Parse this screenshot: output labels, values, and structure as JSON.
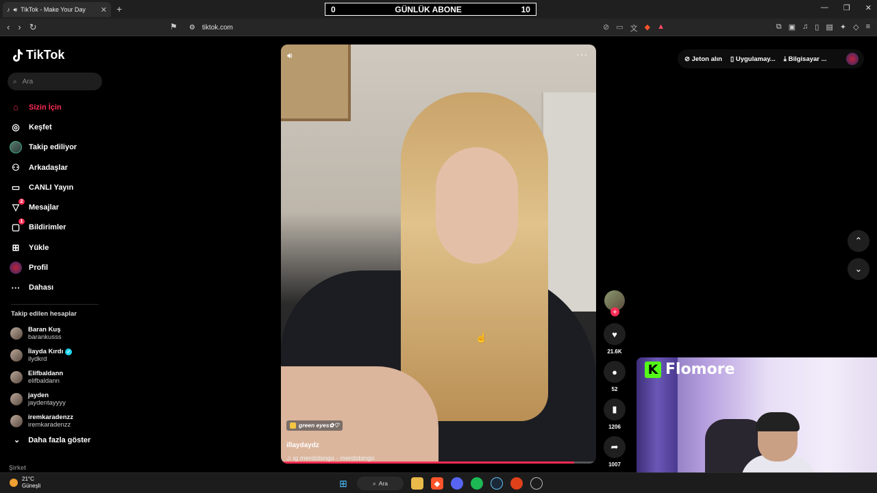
{
  "browser": {
    "tab_title": "TikTok - Make Your Day",
    "url": "tiktok.com"
  },
  "overlay": {
    "left": "0",
    "title": "GÜNLÜK ABONE",
    "right": "10"
  },
  "sidebar": {
    "logo": "TikTok",
    "search_placeholder": "Ara",
    "items": [
      {
        "label": "Sizin İçin",
        "icon": "home-icon"
      },
      {
        "label": "Keşfet",
        "icon": "compass-icon"
      },
      {
        "label": "Takip ediliyor",
        "icon": "following-avatar-icon"
      },
      {
        "label": "Arkadaşlar",
        "icon": "friends-icon"
      },
      {
        "label": "CANLI Yayın",
        "icon": "live-icon"
      },
      {
        "label": "Mesajlar",
        "icon": "messages-icon",
        "badge": "2"
      },
      {
        "label": "Bildirimler",
        "icon": "notifications-icon",
        "badge": "1"
      },
      {
        "label": "Yükle",
        "icon": "upload-icon"
      },
      {
        "label": "Profil",
        "icon": "profile-avatar-icon"
      },
      {
        "label": "Dahası",
        "icon": "more-dots-icon"
      }
    ],
    "following_header": "Takip edilen hesaplar",
    "following": [
      {
        "name": "Baran Kuş",
        "user": "barankusss"
      },
      {
        "name": "İlayda Kırdı",
        "user": "ilydkrd",
        "verified": true
      },
      {
        "name": "Elifbaldann",
        "user": "elifbaldann"
      },
      {
        "name": "jayden",
        "user": "jaydentayyyy"
      },
      {
        "name": "iremkaradenzz",
        "user": "iremkaradenzz"
      }
    ],
    "show_more": "Daha fazla göster",
    "company": "Şirket"
  },
  "video": {
    "tag": "green eyes✿♡",
    "author": "illaydaydz",
    "music": "ig merdobingo - merdobingo",
    "progress": 0.93
  },
  "actions": {
    "likes": "21.6K",
    "comments": "52",
    "saves": "1206",
    "shares": "1007"
  },
  "topbar": {
    "coins": "Jeton alın",
    "app": "Uygulamay...",
    "pc": "Bilgisayar ..."
  },
  "webcam": {
    "brand": "Flomore"
  },
  "taskbar": {
    "temp": "21°C",
    "condition": "Güneşli",
    "search": "Ara"
  },
  "colors": {
    "accent": "#fe2c55",
    "kick_green": "#53fc18"
  }
}
